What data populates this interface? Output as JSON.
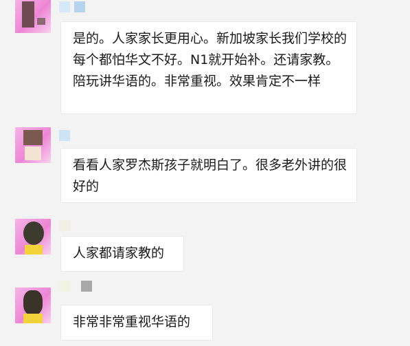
{
  "messages": [
    {
      "sender": "",
      "text": "是的。人家家长更用心。新加坡家长我们学校的每个都怕华文不好。N1就开始补。还请家教。陪玩讲华语的。非常重视。效果肯定不一样"
    },
    {
      "sender": "",
      "text": "看看人家罗杰斯孩子就明白了。很多老外讲的很好的"
    },
    {
      "sender": "",
      "text": "人家都请家教的"
    },
    {
      "sender": "",
      "text": "非常非常重视华语的"
    }
  ],
  "icons": {
    "avatar": "avatar-icon",
    "reply_quote": "quote-icon"
  },
  "colors": {
    "background": "#f3f3f3",
    "bubble": "#ffffff",
    "text": "#1a1a1a",
    "avatar_accent": "#ee86d6"
  }
}
